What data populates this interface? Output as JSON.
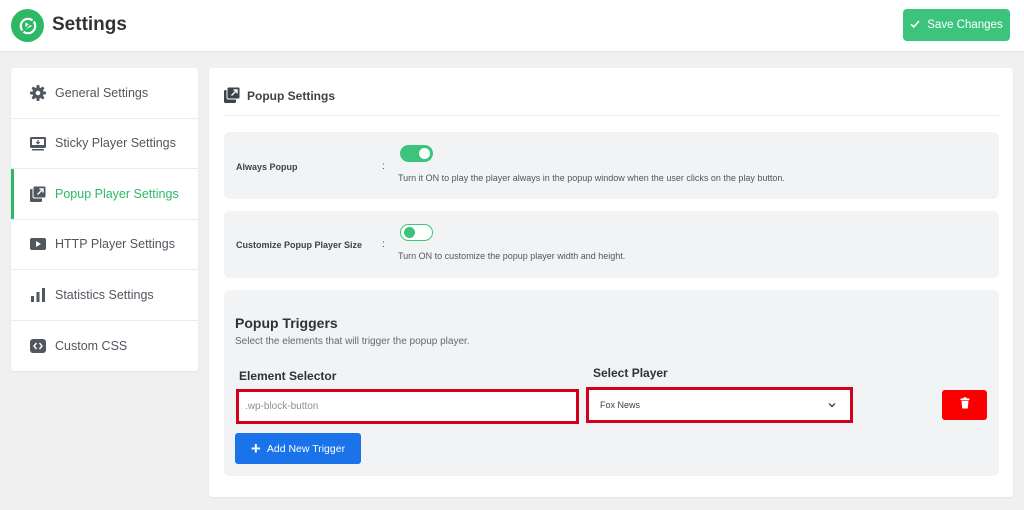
{
  "app": {
    "title": "Settings",
    "save_label": "Save Changes"
  },
  "colors": {
    "accent": "#2db866",
    "primary_blue": "#1a73e8",
    "danger": "#fa0000",
    "highlight": "#d0021b"
  },
  "sidebar": {
    "items": [
      {
        "label": "General Settings",
        "icon": "gear-icon",
        "active": false
      },
      {
        "label": "Sticky Player Settings",
        "icon": "sticky-player-icon",
        "active": false
      },
      {
        "label": "Popup Player Settings",
        "icon": "popup-external-icon",
        "active": true
      },
      {
        "label": "HTTP Player Settings",
        "icon": "play-icon",
        "active": false
      },
      {
        "label": "Statistics Settings",
        "icon": "bar-chart-icon",
        "active": false
      },
      {
        "label": "Custom CSS",
        "icon": "code-icon",
        "active": false
      }
    ]
  },
  "main": {
    "title": "Popup Settings",
    "settings": [
      {
        "label": "Always Popup",
        "colon": ":",
        "enabled": true,
        "help": "Turn it ON to play the player always in the popup window when the user clicks on the play button."
      },
      {
        "label": "Customize Popup Player Size",
        "colon": ":",
        "enabled": false,
        "help": "Turn ON to customize the popup player width and height."
      }
    ],
    "triggers": {
      "title": "Popup Triggers",
      "subtitle": "Select the elements that will trigger the popup player.",
      "element_selector_label": "Element Selector",
      "select_player_label": "Select Player",
      "rows": [
        {
          "selector": ".wp-block-button",
          "player": "Fox News"
        }
      ],
      "add_label": "Add New Trigger"
    }
  }
}
